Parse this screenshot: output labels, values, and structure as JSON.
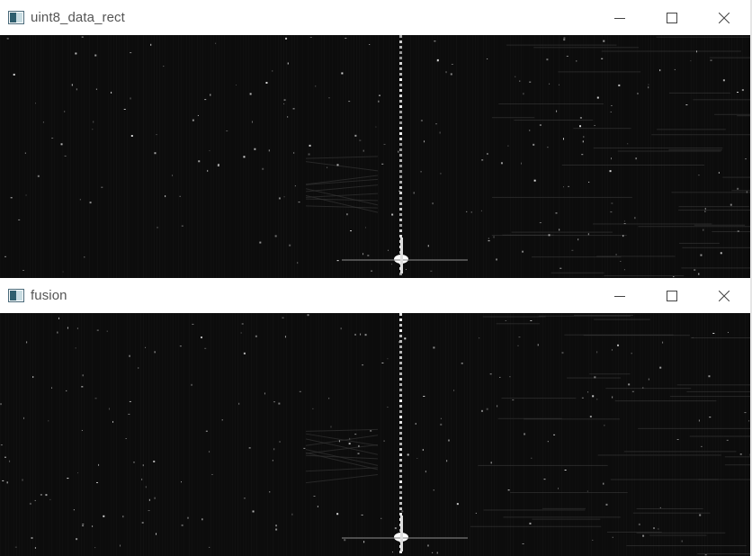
{
  "windows": [
    {
      "title": "uint8_data_rect",
      "icon": "opencv-window-icon",
      "controls": [
        "minimize-icon",
        "maximize-icon",
        "close-icon"
      ]
    },
    {
      "title": "fusion",
      "icon": "opencv-window-icon",
      "controls": [
        "minimize-icon",
        "maximize-icon",
        "close-icon"
      ]
    }
  ],
  "colors": {
    "background": "#0c0c0c",
    "titlebar": "#ffffff",
    "title_text": "#555555"
  }
}
